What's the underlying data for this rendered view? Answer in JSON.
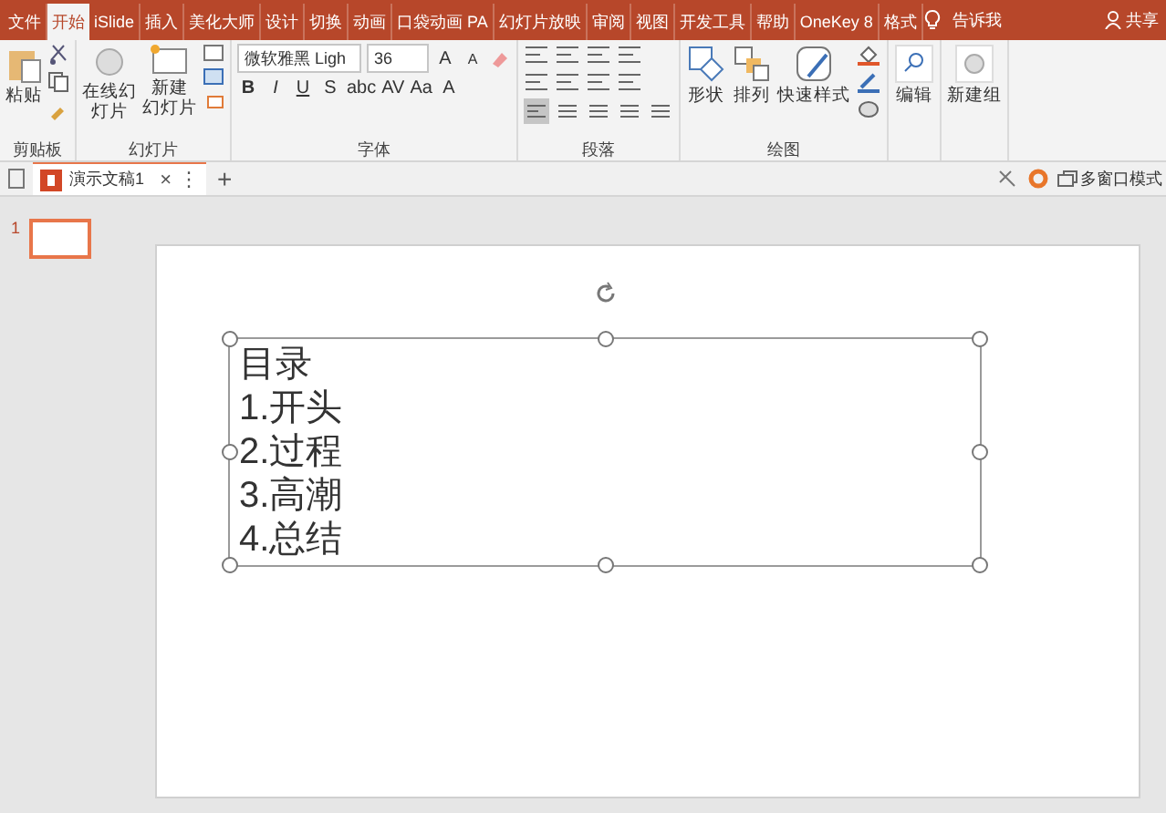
{
  "ribbon_tabs": [
    {
      "label": "文件",
      "selected": false
    },
    {
      "label": "开始",
      "selected": true
    },
    {
      "label": "iSlide",
      "selected": false
    },
    {
      "label": "插入",
      "selected": false
    },
    {
      "label": "美化大师",
      "selected": false
    },
    {
      "label": "设计",
      "selected": false
    },
    {
      "label": "切换",
      "selected": false
    },
    {
      "label": "动画",
      "selected": false
    },
    {
      "label": "口袋动画 PA",
      "selected": false
    },
    {
      "label": "幻灯片放映",
      "selected": false
    },
    {
      "label": "审阅",
      "selected": false
    },
    {
      "label": "视图",
      "selected": false
    },
    {
      "label": "开发工具",
      "selected": false
    },
    {
      "label": "帮助",
      "selected": false
    },
    {
      "label": "OneKey 8",
      "selected": false
    },
    {
      "label": "格式",
      "selected": false
    }
  ],
  "tell_me": "告诉我",
  "share": "共享",
  "clipboard": {
    "label": "剪贴板",
    "paste": "粘贴"
  },
  "slides": {
    "label": "幻灯片",
    "online": [
      "在线幻",
      "灯片"
    ],
    "new_slide": [
      "新建",
      "幻灯片"
    ]
  },
  "font": {
    "label": "字体",
    "font_name": "微软雅黑 Ligh",
    "font_size": "36",
    "grow": "A",
    "shrink": "A",
    "format_buttons": [
      "B",
      "I",
      "U",
      "S",
      "abc",
      "AV",
      "Aa",
      "A"
    ]
  },
  "paragraph": {
    "label": "段落",
    "alignments": [
      {
        "selected": true
      },
      {
        "selected": false
      },
      {
        "selected": false
      },
      {
        "selected": false
      },
      {
        "selected": false
      }
    ]
  },
  "drawing": {
    "label": "绘图",
    "shapes": "形状",
    "arrange": "排列",
    "quick_styles": "快速样式"
  },
  "editing": {
    "label": "编辑"
  },
  "new_group": {
    "label": "新建组"
  },
  "doc_tab": {
    "title": "演示文稿1",
    "close": "×",
    "more": "⋮",
    "add": "+",
    "multi_window": "多窗口模式"
  },
  "thumbnails": [
    {
      "number": "1",
      "selected": true
    }
  ],
  "slide": {
    "text_lines": [
      "目录",
      "1.开头",
      "2.过程",
      "3.高潮",
      "4.总结"
    ],
    "text_box_selected": true
  }
}
